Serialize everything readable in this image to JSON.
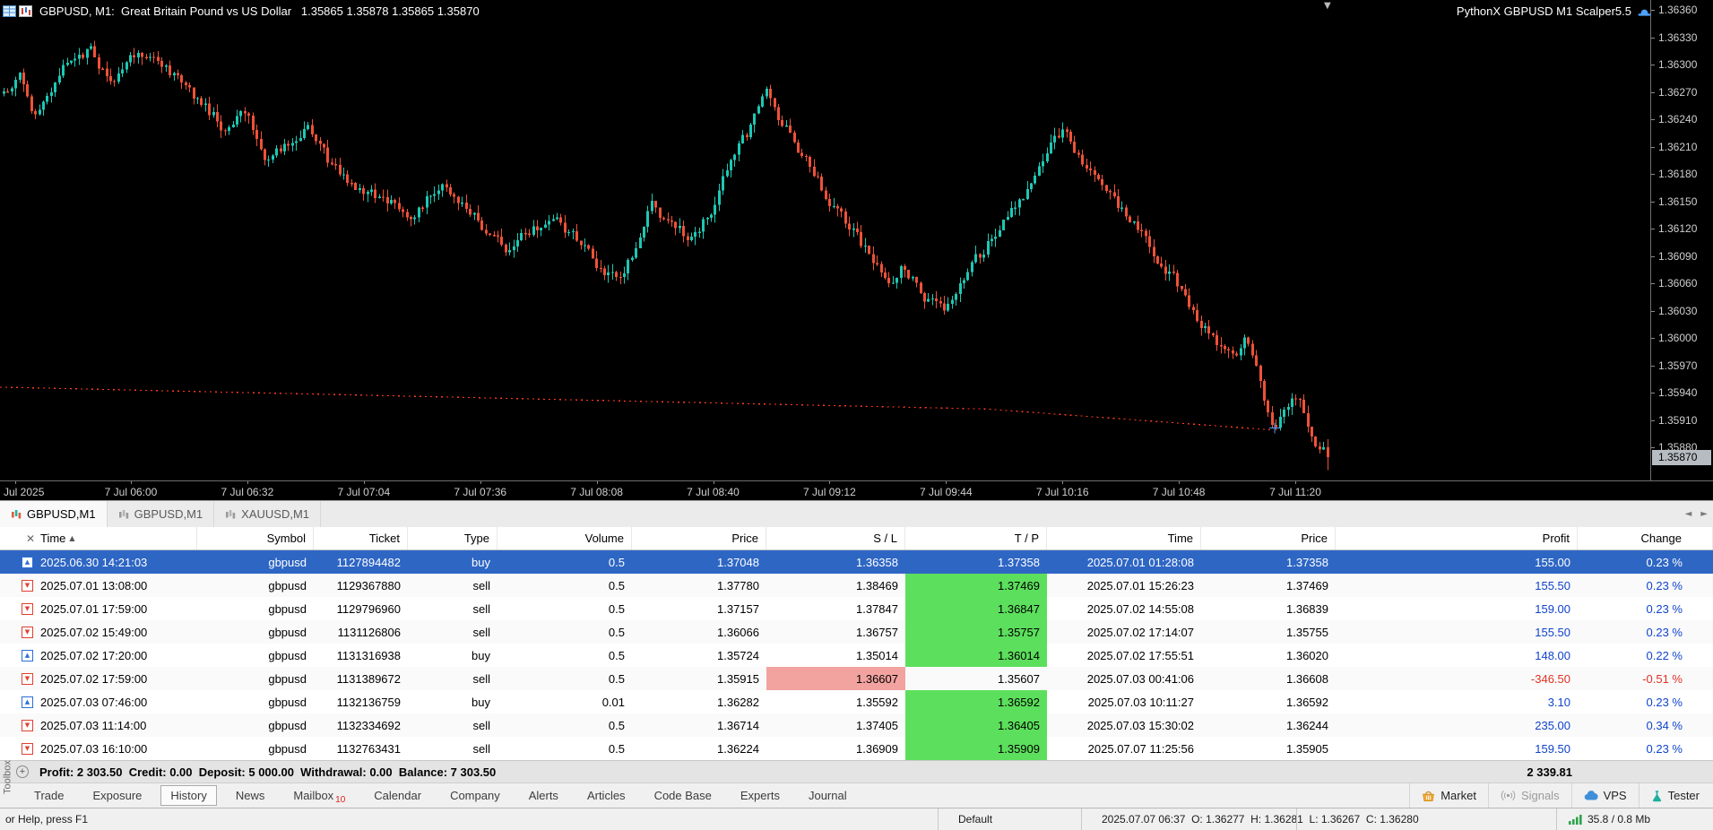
{
  "chart_window": {
    "title": "GBPUSD, M1:  Great Britain Pound vs US Dollar   1.35865 1.35878 1.35865 1.35870",
    "ea_label": "PythonX GBPUSD M1 Scalper5.5"
  },
  "icons": {
    "sort_asc": "▲",
    "close": "✕",
    "down_marker": "▼",
    "buy_arrow": "▲",
    "sell_arrow": "▼",
    "scroll_left": "◄",
    "scroll_right": "►",
    "summary_plus": "+"
  },
  "chart_data": {
    "type": "candlestick",
    "symbol": "GBPUSD",
    "timeframe": "M1",
    "description": "Great Britain Pound vs US Dollar",
    "ohlc": {
      "open": "1.35865",
      "high": "1.35878",
      "low": "1.35865",
      "close": "1.35870"
    },
    "current_price": "1.35870",
    "y_ticks": [
      "1.36360",
      "1.36330",
      "1.36300",
      "1.36270",
      "1.36240",
      "1.36210",
      "1.36180",
      "1.36150",
      "1.36120",
      "1.36090",
      "1.36060",
      "1.36030",
      "1.36000",
      "1.35970",
      "1.35940",
      "1.35910",
      "1.35880"
    ],
    "x_ticks": [
      "Jul 2025",
      "7 Jul 06:00",
      "7 Jul 06:32",
      "7 Jul 07:04",
      "7 Jul 07:36",
      "7 Jul 08:08",
      "7 Jul 08:40",
      "7 Jul 09:12",
      "7 Jul 09:44",
      "7 Jul 10:16",
      "7 Jul 10:48",
      "7 Jul 11:20"
    ],
    "colors": {
      "up": "#1ec8b4",
      "down": "#ee5238",
      "stop_line": "#ff3b1e",
      "bg": "#000000"
    },
    "stop_line": {
      "points": [
        [
          0,
          1.35947
        ],
        [
          1100,
          1.35923
        ],
        [
          1420,
          1.359
        ]
      ]
    },
    "candles": 336,
    "price_path_waypoints": [
      [
        0.0,
        1.3627
      ],
      [
        0.012,
        1.36292
      ],
      [
        0.025,
        1.3624
      ],
      [
        0.045,
        1.36295
      ],
      [
        0.065,
        1.36315
      ],
      [
        0.082,
        1.36278
      ],
      [
        0.1,
        1.36312
      ],
      [
        0.118,
        1.363
      ],
      [
        0.13,
        1.36285
      ],
      [
        0.15,
        1.36258
      ],
      [
        0.168,
        1.36228
      ],
      [
        0.182,
        1.36248
      ],
      [
        0.2,
        1.36195
      ],
      [
        0.218,
        1.36222
      ],
      [
        0.23,
        1.36238
      ],
      [
        0.248,
        1.36185
      ],
      [
        0.262,
        1.3617
      ],
      [
        0.278,
        1.36162
      ],
      [
        0.292,
        1.36148
      ],
      [
        0.31,
        1.36128
      ],
      [
        0.33,
        1.36175
      ],
      [
        0.345,
        1.36155
      ],
      [
        0.362,
        1.3612
      ],
      [
        0.38,
        1.36098
      ],
      [
        0.398,
        1.36122
      ],
      [
        0.415,
        1.36132
      ],
      [
        0.432,
        1.36108
      ],
      [
        0.448,
        1.36082
      ],
      [
        0.465,
        1.3606
      ],
      [
        0.48,
        1.36105
      ],
      [
        0.49,
        1.36148
      ],
      [
        0.505,
        1.36122
      ],
      [
        0.52,
        1.36108
      ],
      [
        0.538,
        1.36148
      ],
      [
        0.55,
        1.36198
      ],
      [
        0.565,
        1.36232
      ],
      [
        0.576,
        1.36268
      ],
      [
        0.588,
        1.36235
      ],
      [
        0.6,
        1.36208
      ],
      [
        0.615,
        1.36172
      ],
      [
        0.63,
        1.36142
      ],
      [
        0.645,
        1.36108
      ],
      [
        0.667,
        1.36062
      ],
      [
        0.68,
        1.36082
      ],
      [
        0.695,
        1.36048
      ],
      [
        0.71,
        1.36028
      ],
      [
        0.725,
        1.36068
      ],
      [
        0.74,
        1.36098
      ],
      [
        0.755,
        1.36128
      ],
      [
        0.77,
        1.36158
      ],
      [
        0.785,
        1.36198
      ],
      [
        0.8,
        1.36228
      ],
      [
        0.815,
        1.36192
      ],
      [
        0.83,
        1.36168
      ],
      [
        0.845,
        1.36142
      ],
      [
        0.864,
        1.36108
      ],
      [
        0.88,
        1.36072
      ],
      [
        0.897,
        1.36038
      ],
      [
        0.912,
        1.36002
      ],
      [
        0.926,
        1.35978
      ],
      [
        0.938,
        1.35998
      ],
      [
        0.948,
        1.35962
      ],
      [
        0.959,
        1.35898
      ],
      [
        0.968,
        1.35918
      ],
      [
        0.975,
        1.35942
      ],
      [
        0.984,
        1.35915
      ],
      [
        0.99,
        1.35888
      ],
      [
        1.0,
        1.3587
      ]
    ]
  },
  "chart_tabs": {
    "tabs": [
      {
        "label": "GBPUSD,M1",
        "active": true
      },
      {
        "label": "GBPUSD,M1",
        "active": false
      },
      {
        "label": "XAUUSD,M1",
        "active": false
      }
    ]
  },
  "toolbox": {
    "side_label": "Toolbox",
    "columns": [
      "Time",
      "Symbol",
      "Ticket",
      "Type",
      "Volume",
      "Price",
      "S / L",
      "T / P",
      "Time",
      "Price",
      "Profit",
      "Change"
    ],
    "rows": [
      {
        "time": "2025.06.30 14:21:03",
        "symbol": "gbpusd",
        "ticket": "1127894482",
        "type": "buy",
        "volume": "0.5",
        "price": "1.37048",
        "sl": "1.36358",
        "sl_hl": false,
        "tp": "1.37358",
        "tp_hl": false,
        "close_time": "2025.07.01 01:28:08",
        "close_price": "1.37358",
        "profit": "155.00",
        "change": "0.23 %",
        "negative": false,
        "selected": true
      },
      {
        "time": "2025.07.01 13:08:00",
        "symbol": "gbpusd",
        "ticket": "1129367880",
        "type": "sell",
        "volume": "0.5",
        "price": "1.37780",
        "sl": "1.38469",
        "sl_hl": false,
        "tp": "1.37469",
        "tp_hl": true,
        "close_time": "2025.07.01 15:26:23",
        "close_price": "1.37469",
        "profit": "155.50",
        "change": "0.23 %",
        "negative": false,
        "selected": false
      },
      {
        "time": "2025.07.01 17:59:00",
        "symbol": "gbpusd",
        "ticket": "1129796960",
        "type": "sell",
        "volume": "0.5",
        "price": "1.37157",
        "sl": "1.37847",
        "sl_hl": false,
        "tp": "1.36847",
        "tp_hl": true,
        "close_time": "2025.07.02 14:55:08",
        "close_price": "1.36839",
        "profit": "159.00",
        "change": "0.23 %",
        "negative": false,
        "selected": false
      },
      {
        "time": "2025.07.02 15:49:00",
        "symbol": "gbpusd",
        "ticket": "1131126806",
        "type": "sell",
        "volume": "0.5",
        "price": "1.36066",
        "sl": "1.36757",
        "sl_hl": false,
        "tp": "1.35757",
        "tp_hl": true,
        "close_time": "2025.07.02 17:14:07",
        "close_price": "1.35755",
        "profit": "155.50",
        "change": "0.23 %",
        "negative": false,
        "selected": false
      },
      {
        "time": "2025.07.02 17:20:00",
        "symbol": "gbpusd",
        "ticket": "1131316938",
        "type": "buy",
        "volume": "0.5",
        "price": "1.35724",
        "sl": "1.35014",
        "sl_hl": false,
        "tp": "1.36014",
        "tp_hl": true,
        "close_time": "2025.07.02 17:55:51",
        "close_price": "1.36020",
        "profit": "148.00",
        "change": "0.22 %",
        "negative": false,
        "selected": false
      },
      {
        "time": "2025.07.02 17:59:00",
        "symbol": "gbpusd",
        "ticket": "1131389672",
        "type": "sell",
        "volume": "0.5",
        "price": "1.35915",
        "sl": "1.36607",
        "sl_hl": true,
        "tp": "1.35607",
        "tp_hl": false,
        "close_time": "2025.07.03 00:41:06",
        "close_price": "1.36608",
        "profit": "-346.50",
        "change": "-0.51 %",
        "negative": true,
        "selected": false
      },
      {
        "time": "2025.07.03 07:46:00",
        "symbol": "gbpusd",
        "ticket": "1132136759",
        "type": "buy",
        "volume": "0.01",
        "price": "1.36282",
        "sl": "1.35592",
        "sl_hl": false,
        "tp": "1.36592",
        "tp_hl": true,
        "close_time": "2025.07.03 10:11:27",
        "close_price": "1.36592",
        "profit": "3.10",
        "change": "0.23 %",
        "negative": false,
        "selected": false
      },
      {
        "time": "2025.07.03 11:14:00",
        "symbol": "gbpusd",
        "ticket": "1132334692",
        "type": "sell",
        "volume": "0.5",
        "price": "1.36714",
        "sl": "1.37405",
        "sl_hl": false,
        "tp": "1.36405",
        "tp_hl": true,
        "close_time": "2025.07.03 15:30:02",
        "close_price": "1.36244",
        "profit": "235.00",
        "change": "0.34 %",
        "negative": false,
        "selected": false
      },
      {
        "time": "2025.07.03 16:10:00",
        "symbol": "gbpusd",
        "ticket": "1132763431",
        "type": "sell",
        "volume": "0.5",
        "price": "1.36224",
        "sl": "1.36909",
        "sl_hl": false,
        "tp": "1.35909",
        "tp_hl": true,
        "close_time": "2025.07.07 11:25:56",
        "close_price": "1.35905",
        "profit": "159.50",
        "change": "0.23 %",
        "negative": false,
        "selected": false
      }
    ],
    "summary": {
      "text": "Profit: 2 303.50  Credit: 0.00  Deposit: 5 000.00  Withdrawal: 0.00  Balance: 7 303.50",
      "total": "2 339.81"
    },
    "tabs": [
      "Trade",
      "Exposure",
      "History",
      "News",
      "Mailbox",
      "Calendar",
      "Company",
      "Alerts",
      "Articles",
      "Code Base",
      "Experts",
      "Journal"
    ],
    "active_tab": "History",
    "mailbox_badge": "10",
    "tools": [
      {
        "label": "Market",
        "icon": "basket-icon"
      },
      {
        "label": "Signals",
        "icon": "signal-icon"
      },
      {
        "label": "VPS",
        "icon": "vps-icon"
      },
      {
        "label": "Tester",
        "icon": "tester-icon"
      }
    ]
  },
  "statusbar": {
    "help": "or Help, press F1",
    "profile": "Default",
    "bar_info": "2025.07.07 06:37  O: 1.36277  H: 1.36281  L: 1.36267  C: 1.36280",
    "traffic": "35.8 / 0.8 Mb"
  }
}
